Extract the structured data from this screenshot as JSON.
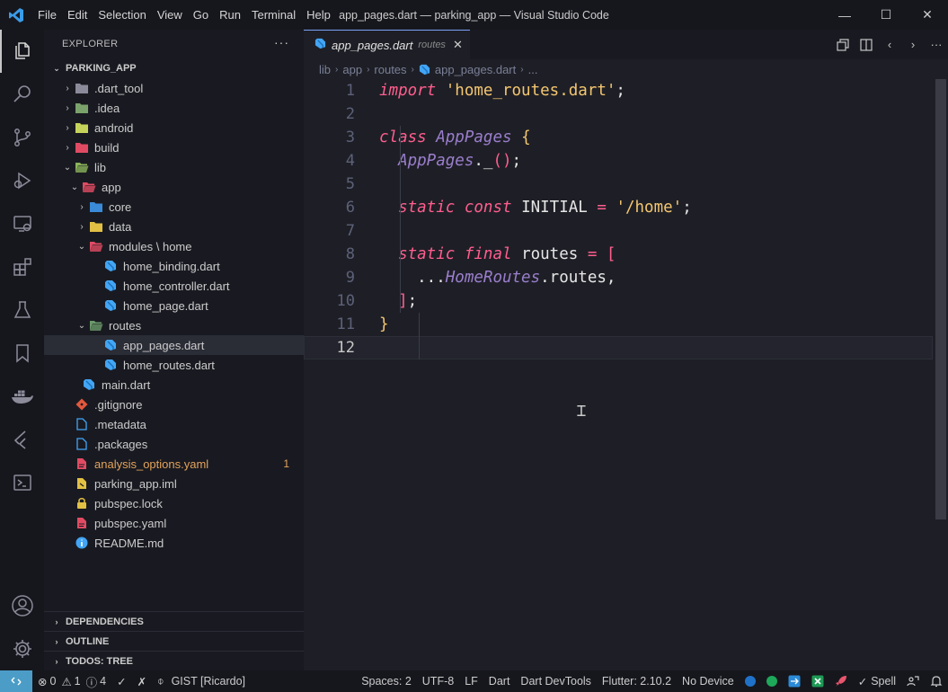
{
  "window": {
    "title": "app_pages.dart — parking_app — Visual Studio Code",
    "minimize": "—",
    "maximize": "☐",
    "close": "✕"
  },
  "menu": [
    "File",
    "Edit",
    "Selection",
    "View",
    "Go",
    "Run",
    "Terminal",
    "Help"
  ],
  "activity_icons": [
    "explorer-icon",
    "search-icon",
    "source-control-icon",
    "run-debug-icon",
    "remote-explorer-icon",
    "extensions-icon",
    "testing-icon",
    "bookmarks-icon",
    "docker-icon",
    "flutter-icon",
    "powershell-icon"
  ],
  "activity_bottom_icons": [
    "account-icon",
    "manage-gear-icon"
  ],
  "sidebar": {
    "header": "EXPLORER",
    "more": "···",
    "root": "PARKING_APP",
    "tree": [
      {
        "label": ".dart_tool",
        "depth": 0,
        "twisty": "›",
        "icon": "folder",
        "color": "#8a8a9a"
      },
      {
        "label": ".idea",
        "depth": 0,
        "twisty": "›",
        "icon": "folder",
        "color": "#7aa26a"
      },
      {
        "label": "android",
        "depth": 0,
        "twisty": "›",
        "icon": "folder",
        "color": "#c5d35a"
      },
      {
        "label": "build",
        "depth": 0,
        "twisty": "›",
        "icon": "folder",
        "color": "#e04b63"
      },
      {
        "label": "lib",
        "depth": 0,
        "twisty": "⌄",
        "icon": "folder-open",
        "color": "#8ab35a"
      },
      {
        "label": "app",
        "depth": 1,
        "twisty": "⌄",
        "icon": "folder-open",
        "color": "#e04b63"
      },
      {
        "label": "core",
        "depth": 2,
        "twisty": "›",
        "icon": "folder",
        "color": "#3a8ad8"
      },
      {
        "label": "data",
        "depth": 2,
        "twisty": "›",
        "icon": "folder",
        "color": "#e2c044"
      },
      {
        "label": "modules \\ home",
        "depth": 2,
        "twisty": "⌄",
        "icon": "folder-open",
        "color": "#e04b63"
      },
      {
        "label": "home_binding.dart",
        "depth": 3,
        "twisty": "",
        "icon": "dart",
        "color": "#42a5f5"
      },
      {
        "label": "home_controller.dart",
        "depth": 3,
        "twisty": "",
        "icon": "dart",
        "color": "#42a5f5"
      },
      {
        "label": "home_page.dart",
        "depth": 3,
        "twisty": "",
        "icon": "dart",
        "color": "#42a5f5"
      },
      {
        "label": "routes",
        "depth": 2,
        "twisty": "⌄",
        "icon": "folder-open",
        "color": "#6a9a6a"
      },
      {
        "label": "app_pages.dart",
        "depth": 3,
        "twisty": "",
        "icon": "dart",
        "color": "#42a5f5",
        "selected": true
      },
      {
        "label": "home_routes.dart",
        "depth": 3,
        "twisty": "",
        "icon": "dart",
        "color": "#42a5f5"
      },
      {
        "label": "main.dart",
        "depth": 1,
        "twisty": "",
        "icon": "dart",
        "color": "#42a5f5"
      },
      {
        "label": ".gitignore",
        "depth": 0,
        "twisty": "",
        "icon": "git",
        "color": "#e2583e"
      },
      {
        "label": ".metadata",
        "depth": 0,
        "twisty": "",
        "icon": "file",
        "color": "#42a5f5"
      },
      {
        "label": ".packages",
        "depth": 0,
        "twisty": "",
        "icon": "file",
        "color": "#42a5f5"
      },
      {
        "label": "analysis_options.yaml",
        "depth": 0,
        "twisty": "",
        "icon": "yaml",
        "color": "#e04b63",
        "warn": true,
        "badge": "1"
      },
      {
        "label": "parking_app.iml",
        "depth": 0,
        "twisty": "",
        "icon": "iml",
        "color": "#e2c044"
      },
      {
        "label": "pubspec.lock",
        "depth": 0,
        "twisty": "",
        "icon": "lock",
        "color": "#e2c044"
      },
      {
        "label": "pubspec.yaml",
        "depth": 0,
        "twisty": "",
        "icon": "yaml",
        "color": "#e04b63"
      },
      {
        "label": "README.md",
        "depth": 0,
        "twisty": "",
        "icon": "info",
        "color": "#42a5f5"
      }
    ],
    "bottom_sections": [
      "DEPENDENCIES",
      "OUTLINE",
      "TODOS: TREE"
    ]
  },
  "tab": {
    "label": "app_pages.dart",
    "description": "routes",
    "close": "✕"
  },
  "breadcrumb": [
    "lib",
    "app",
    "routes",
    "app_pages.dart",
    "..."
  ],
  "code": {
    "current_line": 12,
    "lines": [
      [
        [
          "kw",
          "import"
        ],
        [
          "t",
          " "
        ],
        [
          "str",
          "'home_routes.dart'"
        ],
        [
          "punc",
          ";"
        ]
      ],
      [],
      [
        [
          "kw",
          "class"
        ],
        [
          "t",
          " "
        ],
        [
          "cls",
          "AppPages"
        ],
        [
          "t",
          " "
        ],
        [
          "brace",
          "{"
        ]
      ],
      [
        [
          "t",
          "  "
        ],
        [
          "cls",
          "AppPages"
        ],
        [
          "punc",
          "."
        ],
        [
          "t",
          "_"
        ],
        [
          "paren",
          "()"
        ],
        [
          "punc",
          ";"
        ]
      ],
      [],
      [
        [
          "t",
          "  "
        ],
        [
          "kw",
          "static"
        ],
        [
          "t",
          " "
        ],
        [
          "kw",
          "const"
        ],
        [
          "t",
          " INITIAL "
        ],
        [
          "op",
          "="
        ],
        [
          "t",
          " "
        ],
        [
          "str",
          "'/home'"
        ],
        [
          "punc",
          ";"
        ]
      ],
      [],
      [
        [
          "t",
          "  "
        ],
        [
          "kw",
          "static"
        ],
        [
          "t",
          " "
        ],
        [
          "kw",
          "final"
        ],
        [
          "t",
          " routes "
        ],
        [
          "op",
          "="
        ],
        [
          "t",
          " "
        ],
        [
          "paren",
          "["
        ]
      ],
      [
        [
          "t",
          "    ..."
        ],
        [
          "cls",
          "HomeRoutes"
        ],
        [
          "punc",
          "."
        ],
        [
          "t",
          "routes,"
        ]
      ],
      [
        [
          "t",
          "  "
        ],
        [
          "paren",
          "]"
        ],
        [
          "punc",
          ";"
        ]
      ],
      [
        [
          "brace",
          "}"
        ]
      ],
      []
    ]
  },
  "statusbar": {
    "remote": "⨯",
    "errors": "0",
    "warnings": "1",
    "infos": "4",
    "check": "✓",
    "x": "✗",
    "gist": "GIST [Ricardo]",
    "spaces": "Spaces: 2",
    "encoding": "UTF-8",
    "eol": "LF",
    "language": "Dart",
    "devtools": "Dart DevTools",
    "flutter": "Flutter: 2.10.2",
    "device": "No Device",
    "spell": "Spell"
  }
}
